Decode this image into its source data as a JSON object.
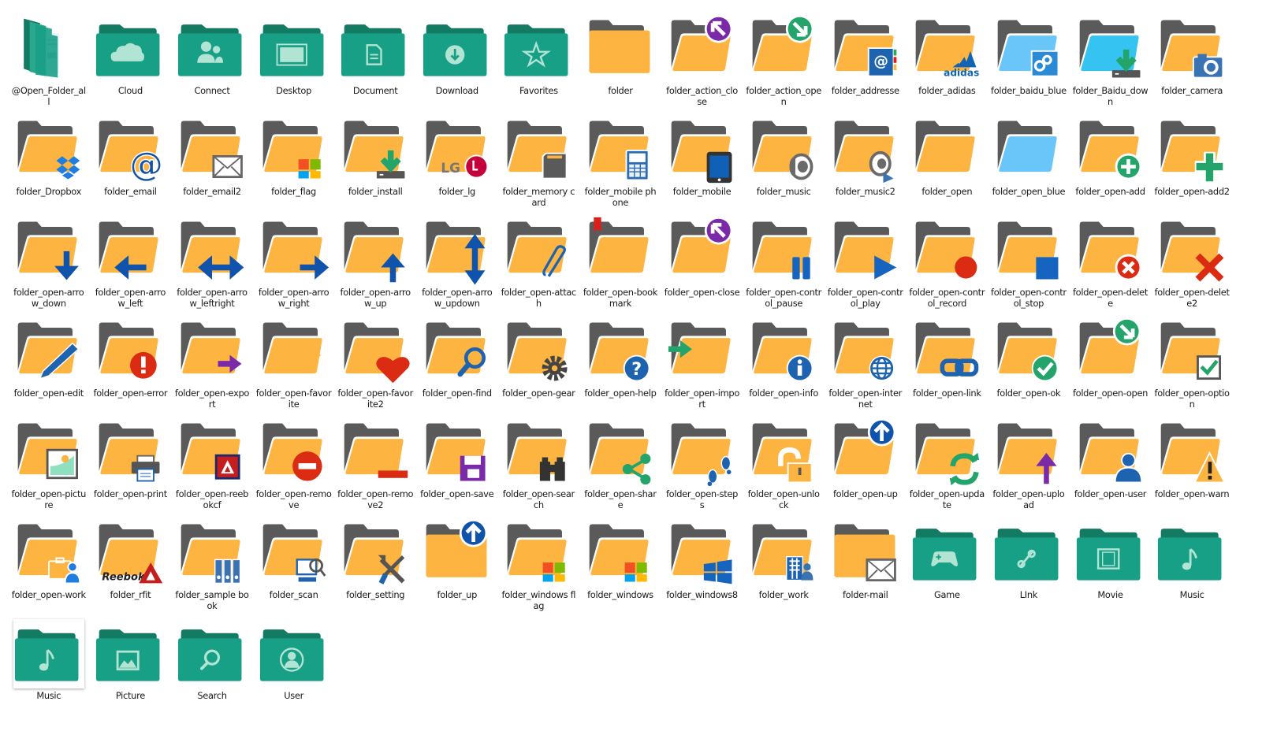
{
  "view": "icon-grid",
  "colors": {
    "teal_back": "#137a63",
    "teal_front": "#18a086",
    "teal_glyph": "#b2e4d4",
    "folder_back": "#5a5a5a",
    "folder_front": "#fdb440",
    "blue_front": "#6ac6f8",
    "accent_blue": "#0f5fb3",
    "accent_red": "#db2b12",
    "accent_green": "#22a46a",
    "accent_purple": "#7a2aa8"
  },
  "items": [
    {
      "label": "@Open_Folder_all",
      "style": "teal-stack",
      "glyph": "documents-icon"
    },
    {
      "label": "Cloud",
      "style": "teal",
      "glyph": "cloud-icon"
    },
    {
      "label": "Connect",
      "style": "teal",
      "glyph": "users-icon"
    },
    {
      "label": "Desktop",
      "style": "teal",
      "glyph": "monitor-icon"
    },
    {
      "label": "Document",
      "style": "teal",
      "glyph": "document-icon"
    },
    {
      "label": "Download",
      "style": "teal",
      "glyph": "download-icon"
    },
    {
      "label": "Favorites",
      "style": "teal",
      "glyph": "star-icon"
    },
    {
      "label": "folder",
      "style": "closed",
      "glyph": ""
    },
    {
      "label": "folder_action_close",
      "style": "open",
      "glyph": "arrow-upleft-circle-icon",
      "color": "#7a2aa8"
    },
    {
      "label": "folder_action_open",
      "style": "open",
      "glyph": "arrow-downright-circle-icon",
      "color": "#22a46a"
    },
    {
      "label": "folder_addresse",
      "style": "open",
      "glyph": "address-book-icon",
      "color": "#1e63b0"
    },
    {
      "label": "folder_adidas",
      "style": "open",
      "glyph": "adidas-logo-icon",
      "color": "#1164b4"
    },
    {
      "label": "folder_baidu_blue",
      "style": "open-blue",
      "glyph": "baidu-cloud-icon",
      "color": "#2a8ad6"
    },
    {
      "label": "folder_Baidu_down",
      "style": "open-cyan",
      "glyph": "install-icon",
      "color": "#22a46a"
    },
    {
      "label": "folder_camera",
      "style": "open",
      "glyph": "camera-icon",
      "color": "#3a73b4"
    },
    {
      "label": "folder_Dropbox",
      "style": "open",
      "glyph": "dropbox-icon",
      "color": "#1e7de0"
    },
    {
      "label": "folder_email",
      "style": "open",
      "glyph": "at-sign-icon",
      "color": "#1253a8"
    },
    {
      "label": "folder_email2",
      "style": "open",
      "glyph": "envelope-icon",
      "color": "#666666"
    },
    {
      "label": "folder_flag",
      "style": "open",
      "glyph": "windows-flag-icon",
      "color": "#f25022"
    },
    {
      "label": "folder_install",
      "style": "open",
      "glyph": "install-icon",
      "color": "#22a46a"
    },
    {
      "label": "folder_lg",
      "style": "open",
      "glyph": "lg-logo-icon",
      "color": "#c4003c"
    },
    {
      "label": "folder_memory card",
      "style": "open",
      "glyph": "sd-card-icon",
      "color": "#5a5a5a"
    },
    {
      "label": "folder_mobile phone",
      "style": "open",
      "glyph": "phone-icon",
      "color": "#2b6cb0"
    },
    {
      "label": "folder_mobile",
      "style": "open",
      "glyph": "tablet-icon",
      "color": "#1160b8"
    },
    {
      "label": "folder_music",
      "style": "open",
      "glyph": "speaker-icon",
      "color": "#6a6a6a"
    },
    {
      "label": "folder_music2",
      "style": "open",
      "glyph": "speaker-play-icon",
      "color": "#6a6a6a"
    },
    {
      "label": "folder_open",
      "style": "open",
      "glyph": ""
    },
    {
      "label": "folder_open_blue",
      "style": "open-blue",
      "glyph": ""
    },
    {
      "label": "folder_open-add",
      "style": "open",
      "glyph": "plus-circle-icon",
      "color": "#22a46a"
    },
    {
      "label": "folder_open-add2",
      "style": "open",
      "glyph": "plus-icon",
      "color": "#22a46a"
    },
    {
      "label": "folder_open-arrow_down",
      "style": "open",
      "glyph": "arrow-down-icon",
      "color": "#1053ac"
    },
    {
      "label": "folder_open-arrow_left",
      "style": "open",
      "glyph": "arrow-left-icon",
      "color": "#1053ac"
    },
    {
      "label": "folder_open-arrow_leftright",
      "style": "open",
      "glyph": "arrow-leftright-icon",
      "color": "#1053ac"
    },
    {
      "label": "folder_open-arrow_right",
      "style": "open",
      "glyph": "arrow-right-icon",
      "color": "#1053ac"
    },
    {
      "label": "folder_open-arrow_up",
      "style": "open",
      "glyph": "arrow-up-icon",
      "color": "#1053ac"
    },
    {
      "label": "folder_open-arrow_updown",
      "style": "open",
      "glyph": "arrow-updown-icon",
      "color": "#1053ac"
    },
    {
      "label": "folder_open-attach",
      "style": "open",
      "glyph": "paperclip-icon",
      "color": "#1e63b0"
    },
    {
      "label": "folder_open-bookmark",
      "style": "open",
      "glyph": "bookmark-icon",
      "color": "#d8201c"
    },
    {
      "label": "folder_open-close",
      "style": "open",
      "glyph": "arrow-upleft-circle-icon",
      "color": "#7a2aa8"
    },
    {
      "label": "folder_open-control_pause",
      "style": "open",
      "glyph": "pause-icon",
      "color": "#1565c0"
    },
    {
      "label": "folder_open-control_play",
      "style": "open",
      "glyph": "play-icon",
      "color": "#1565c0"
    },
    {
      "label": "folder_open-control_record",
      "style": "open",
      "glyph": "record-icon",
      "color": "#db2b12"
    },
    {
      "label": "folder_open-control_stop",
      "style": "open",
      "glyph": "stop-icon",
      "color": "#1565c0"
    },
    {
      "label": "folder_open-delete",
      "style": "open",
      "glyph": "x-circle-icon",
      "color": "#db2b12"
    },
    {
      "label": "folder_open-delete2",
      "style": "open",
      "glyph": "x-icon",
      "color": "#db2b12"
    },
    {
      "label": "folder_open-edit",
      "style": "open",
      "glyph": "pencil-icon",
      "color": "#1e63b0"
    },
    {
      "label": "folder_open-error",
      "style": "open",
      "glyph": "exclamation-circle-icon",
      "color": "#db2b12"
    },
    {
      "label": "folder_open-export",
      "style": "open",
      "glyph": "export-arrow-icon",
      "color": "#7a2aa8"
    },
    {
      "label": "folder_open-favorite",
      "style": "open",
      "glyph": "star-icon",
      "color": "#fdb440"
    },
    {
      "label": "folder_open-favorite2",
      "style": "open",
      "glyph": "heart-icon",
      "color": "#db2b12"
    },
    {
      "label": "folder_open-find",
      "style": "open",
      "glyph": "magnifier-icon",
      "color": "#1e63b0"
    },
    {
      "label": "folder_open-gear",
      "style": "open",
      "glyph": "gear-icon",
      "color": "#444444"
    },
    {
      "label": "folder_open-help",
      "style": "open",
      "glyph": "question-circle-icon",
      "color": "#1e63b0"
    },
    {
      "label": "folder_open-import",
      "style": "open",
      "glyph": "import-arrow-icon",
      "color": "#22a46a"
    },
    {
      "label": "folder_open-info",
      "style": "open",
      "glyph": "info-circle-icon",
      "color": "#1e63b0"
    },
    {
      "label": "folder_open-internet",
      "style": "open",
      "glyph": "globe-icon",
      "color": "#1e63b0"
    },
    {
      "label": "folder_open-link",
      "style": "open",
      "glyph": "link-icon",
      "color": "#1e63b0"
    },
    {
      "label": "folder_open-ok",
      "style": "open",
      "glyph": "check-circle-icon",
      "color": "#22a46a"
    },
    {
      "label": "folder_open-open",
      "style": "open",
      "glyph": "arrow-downright-circle-icon",
      "color": "#22a46a"
    },
    {
      "label": "folder_open-option",
      "style": "open",
      "glyph": "checkbox-icon",
      "color": "#22a46a"
    },
    {
      "label": "folder_open-picture",
      "style": "open",
      "glyph": "picture-icon",
      "color": "#7dd3b4"
    },
    {
      "label": "folder_open-print",
      "style": "open",
      "glyph": "printer-icon",
      "color": "#1e63b0"
    },
    {
      "label": "folder_open-reebokcf",
      "style": "open",
      "glyph": "reebok-crossfit-icon",
      "color": "#c41e1e"
    },
    {
      "label": "folder_open-remove",
      "style": "open",
      "glyph": "minus-circle-icon",
      "color": "#db2b12"
    },
    {
      "label": "folder_open-remove2",
      "style": "open",
      "glyph": "minus-icon",
      "color": "#db2b12"
    },
    {
      "label": "folder_open-save",
      "style": "open",
      "glyph": "floppy-icon",
      "color": "#7a2aa8"
    },
    {
      "label": "folder_open-search",
      "style": "open",
      "glyph": "binoculars-icon",
      "color": "#333333"
    },
    {
      "label": "folder_open-share",
      "style": "open",
      "glyph": "share-icon",
      "color": "#22a46a"
    },
    {
      "label": "folder_open-steps",
      "style": "open",
      "glyph": "footprints-icon",
      "color": "#1e63b0"
    },
    {
      "label": "folder_open-unlock",
      "style": "open",
      "glyph": "unlock-icon",
      "color": "#fdb440"
    },
    {
      "label": "folder_open-up",
      "style": "open",
      "glyph": "arrow-up-circle-icon",
      "color": "#1053ac"
    },
    {
      "label": "folder_open-update",
      "style": "open",
      "glyph": "refresh-icon",
      "color": "#22a46a"
    },
    {
      "label": "folder_open-upload",
      "style": "open",
      "glyph": "upload-arrow-icon",
      "color": "#7a2aa8"
    },
    {
      "label": "folder_open-user",
      "style": "open",
      "glyph": "user-icon",
      "color": "#1e63b0"
    },
    {
      "label": "folder_open-warn",
      "style": "open",
      "glyph": "warning-icon",
      "color": "#fdb440"
    },
    {
      "label": "folder_open-work",
      "style": "open",
      "glyph": "briefcase-user-icon",
      "color": "#1e7de0"
    },
    {
      "label": "folder_rfit",
      "style": "open",
      "glyph": "reebok-logo-icon",
      "color": "#c41e1e"
    },
    {
      "label": "folder_sample book",
      "style": "open",
      "glyph": "binders-icon",
      "color": "#3a73b4"
    },
    {
      "label": "folder_scan",
      "style": "open",
      "glyph": "scan-icon",
      "color": "#1e63b0"
    },
    {
      "label": "folder_setting",
      "style": "open",
      "glyph": "tools-icon",
      "color": "#555555"
    },
    {
      "label": "folder_up",
      "style": "closed",
      "glyph": "arrow-up-circle-icon",
      "color": "#1053ac"
    },
    {
      "label": "folder_windows flag",
      "style": "open",
      "glyph": "windows-flag-icon",
      "color": "#f25022"
    },
    {
      "label": "folder_windows",
      "style": "open",
      "glyph": "windows-flag-icon",
      "color": "#f25022"
    },
    {
      "label": "folder_windows8",
      "style": "open",
      "glyph": "windows8-icon",
      "color": "#1565c0"
    },
    {
      "label": "folder_work",
      "style": "open",
      "glyph": "building-user-icon",
      "color": "#1e63b0"
    },
    {
      "label": "folder-mail",
      "style": "closed",
      "glyph": "envelope-icon",
      "color": "#666666"
    },
    {
      "label": "Game",
      "style": "teal",
      "glyph": "gamepad-icon"
    },
    {
      "label": "LInk",
      "style": "teal",
      "glyph": "link-icon"
    },
    {
      "label": "Movie",
      "style": "teal",
      "glyph": "film-icon"
    },
    {
      "label": "Music",
      "style": "teal",
      "glyph": "music-note-icon"
    },
    {
      "label": "Music",
      "style": "teal",
      "glyph": "music-note-icon",
      "selected": true
    },
    {
      "label": "Picture",
      "style": "teal",
      "glyph": "picture-icon"
    },
    {
      "label": "Search",
      "style": "teal",
      "glyph": "magnifier-icon"
    },
    {
      "label": "User",
      "style": "teal",
      "glyph": "user-circle-icon"
    }
  ]
}
